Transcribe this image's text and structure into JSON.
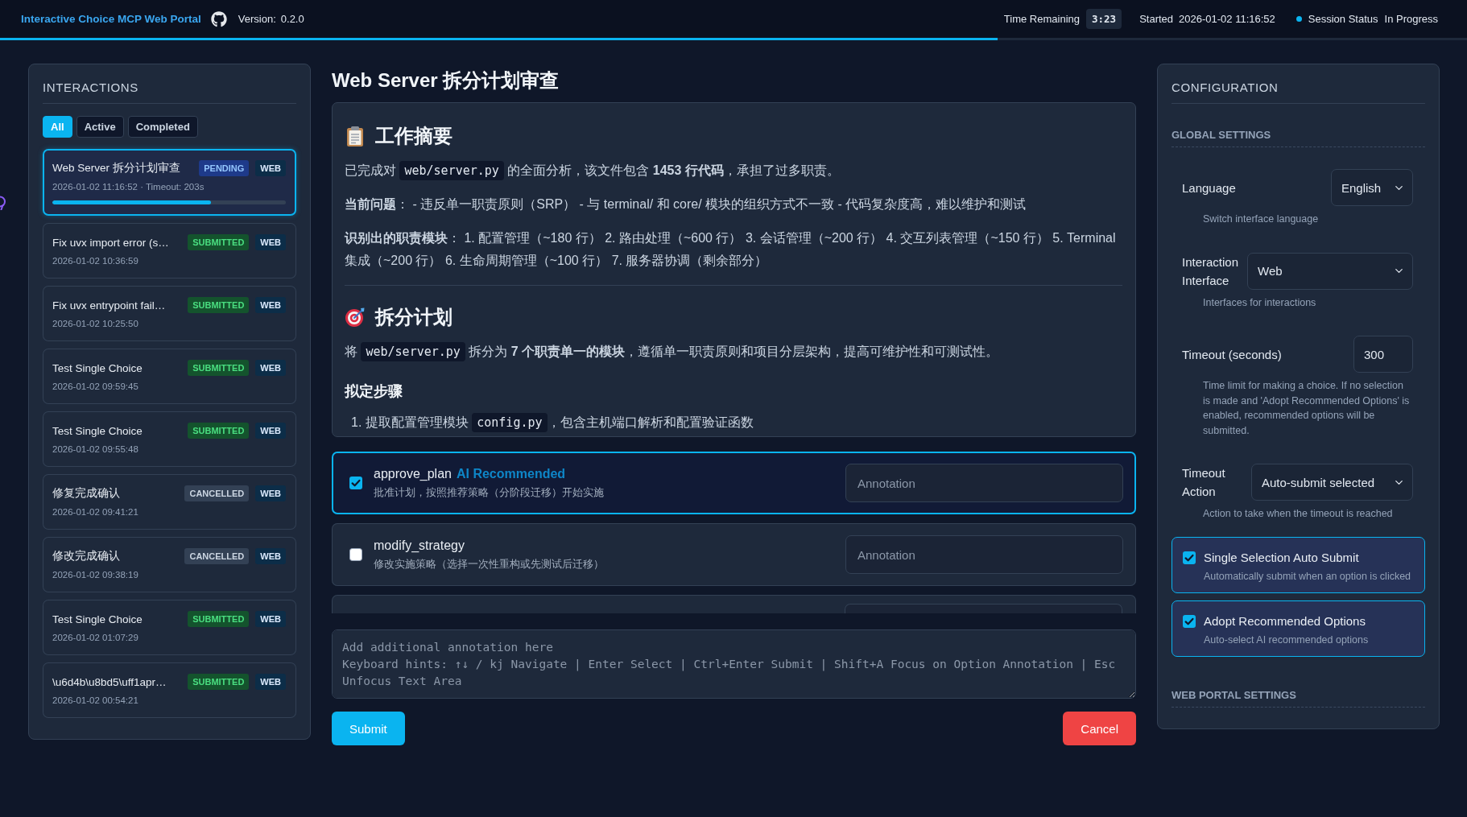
{
  "header": {
    "title": "Interactive Choice MCP Web Portal",
    "version_label": "Version:",
    "version": "0.2.0",
    "time_remaining_label": "Time Remaining",
    "time_remaining": "3:23",
    "started_label": "Started",
    "started": "2026-01-02 11:16:52",
    "session_status_label": "Session Status",
    "session_status": "In Progress",
    "session_active": true,
    "progress": {
      "level": 0.68
    }
  },
  "interactions": {
    "title": "INTERACTIONS",
    "filters": [
      {
        "label": "All",
        "selected": true
      },
      {
        "label": "Active",
        "selected": false
      },
      {
        "label": "Completed",
        "selected": false
      }
    ],
    "items": [
      {
        "title": "Web Server 拆分计划审查",
        "time": "2026-01-02 11:16:52 · Timeout: 203s",
        "status": {
          "label": "PENDING",
          "kind": "pending"
        },
        "channel": "WEB",
        "selected": true,
        "progress": {
          "level": 0.68
        }
      },
      {
        "title": "Fix uvx import error (s…",
        "time": "2026-01-02 10:36:59",
        "status": {
          "label": "SUBMITTED",
          "kind": "submitted"
        },
        "channel": "WEB",
        "selected": false
      },
      {
        "title": "Fix uvx entrypoint fail…",
        "time": "2026-01-02 10:25:50",
        "status": {
          "label": "SUBMITTED",
          "kind": "submitted"
        },
        "channel": "WEB",
        "selected": false
      },
      {
        "title": "Test Single Choice",
        "time": "2026-01-02 09:59:45",
        "status": {
          "label": "SUBMITTED",
          "kind": "submitted"
        },
        "channel": "WEB",
        "selected": false
      },
      {
        "title": "Test Single Choice",
        "time": "2026-01-02 09:55:48",
        "status": {
          "label": "SUBMITTED",
          "kind": "submitted"
        },
        "channel": "WEB",
        "selected": false
      },
      {
        "title": "修复完成确认",
        "time": "2026-01-02 09:41:21",
        "status": {
          "label": "CANCELLED",
          "kind": "cancelled"
        },
        "channel": "WEB",
        "selected": false
      },
      {
        "title": "修改完成确认",
        "time": "2026-01-02 09:38:19",
        "status": {
          "label": "CANCELLED",
          "kind": "cancelled"
        },
        "channel": "WEB",
        "selected": false
      },
      {
        "title": "Test Single Choice",
        "time": "2026-01-02 01:07:29",
        "status": {
          "label": "SUBMITTED",
          "kind": "submitted"
        },
        "channel": "WEB",
        "selected": false
      },
      {
        "title": "\\u6d4b\\u8bd5\\uff1apr…",
        "time": "2026-01-02 00:54:21",
        "status": {
          "label": "SUBMITTED",
          "kind": "submitted"
        },
        "channel": "WEB",
        "selected": false
      }
    ]
  },
  "request": {
    "title": "Web Server 拆分计划审查",
    "content": [
      {
        "kind": "heading",
        "text": "工作摘要"
      },
      {
        "kind": "paragraph",
        "segments": [
          {
            "kind": "text",
            "text": "已完成对 "
          },
          {
            "kind": "code",
            "text": "web/server.py"
          },
          {
            "kind": "text",
            "text": " 的全面分析，该文件包含 **1453 行代码**，承担了过多职责。"
          }
        ]
      },
      {
        "kind": "paragraph",
        "segments": [
          {
            "kind": "text",
            "text": "**当前问题**： - 违反单一职责原则（SRP） - 与 terminal/ 和 core/ 模块的组织方式不一致 - 代码复杂度高，难以维护和测试"
          }
        ]
      },
      {
        "kind": "paragraph",
        "segments": [
          {
            "kind": "text",
            "text": "**识别出的职责模块**： 1. 配置管理（~180 行） 2. 路由处理（~600 行） 3. 会话管理（~200 行） 4. 交互列表管理（~150 行） 5. Terminal 集成（~200 行） 6. 生命周期管理（~100 行） 7. 服务器协调（剩余部分）"
          }
        ]
      },
      {
        "kind": "divider"
      },
      {
        "kind": "heading",
        "text": "拆分计划"
      },
      {
        "kind": "paragraph",
        "segments": [
          {
            "kind": "text",
            "text": "将 "
          },
          {
            "kind": "code",
            "text": "web/server.py"
          },
          {
            "kind": "text",
            "text": " 拆分为 **7 个职责单一的模块**，遵循单一职责原则和项目分层架构，提高可维护性和可测试性。"
          }
        ]
      },
      {
        "kind": "subheading",
        "text": "拟定步骤"
      },
      {
        "kind": "list_item",
        "segments": [
          {
            "kind": "text",
            "text": "1. 提取配置管理模块 "
          },
          {
            "kind": "code",
            "text": "config.py"
          },
          {
            "kind": "text",
            "text": "，包含主机端口解析和配置验证函数"
          }
        ]
      }
    ],
    "options": [
      {
        "name": "approve_plan",
        "badge": "AI Recommended",
        "description": "批准计划，按照推荐策略（分阶段迁移）开始实施",
        "checked": true,
        "highlighted": true,
        "annotation": {
          "placeholder": "Annotation"
        }
      },
      {
        "name": "modify_strategy",
        "description": "修改实施策略（选择一次性重构或先测试后迁移）",
        "checked": false,
        "highlighted": false,
        "annotation": {
          "placeholder": "Annotation"
        }
      }
    ],
    "more_options_below": true,
    "annotation": {
      "placeholder": "Add additional annotation here\nKeyboard hints: ↑↓ / kj Navigate | Enter Select | Ctrl+Enter Submit | Shift+A Focus on Option Annotation | Esc Unfocus Text Area"
    },
    "actions": [
      {
        "label": "Submit",
        "kind": "primary"
      },
      {
        "label": "Cancel",
        "kind": "danger"
      }
    ]
  },
  "configuration": {
    "title": "CONFIGURATION",
    "sections": [
      {
        "title": "GLOBAL SETTINGS",
        "settings": [
          {
            "kind": "select",
            "label": "Language",
            "value": "English",
            "hint": "Switch interface language"
          },
          {
            "kind": "select",
            "label": "Interaction Interface",
            "value": "Web",
            "hint": "Interfaces for interactions"
          },
          {
            "kind": "number",
            "label": "Timeout (seconds)",
            "value": "300",
            "hint": "Time limit for making a choice. If no selection is made and 'Adopt Recommended Options' is enabled, recommended options will be submitted."
          },
          {
            "kind": "select",
            "label": "Timeout Action",
            "value": "Auto-submit selected",
            "hint": "Action to take when the timeout is reached"
          },
          {
            "kind": "toggle",
            "label": "Single Selection Auto Submit",
            "hint": "Automatically submit when an option is clicked",
            "checked": true
          },
          {
            "kind": "toggle",
            "label": "Adopt Recommended Options",
            "hint": "Auto-select AI recommended options",
            "checked": true
          }
        ]
      },
      {
        "title": "WEB PORTAL SETTINGS"
      }
    ]
  }
}
